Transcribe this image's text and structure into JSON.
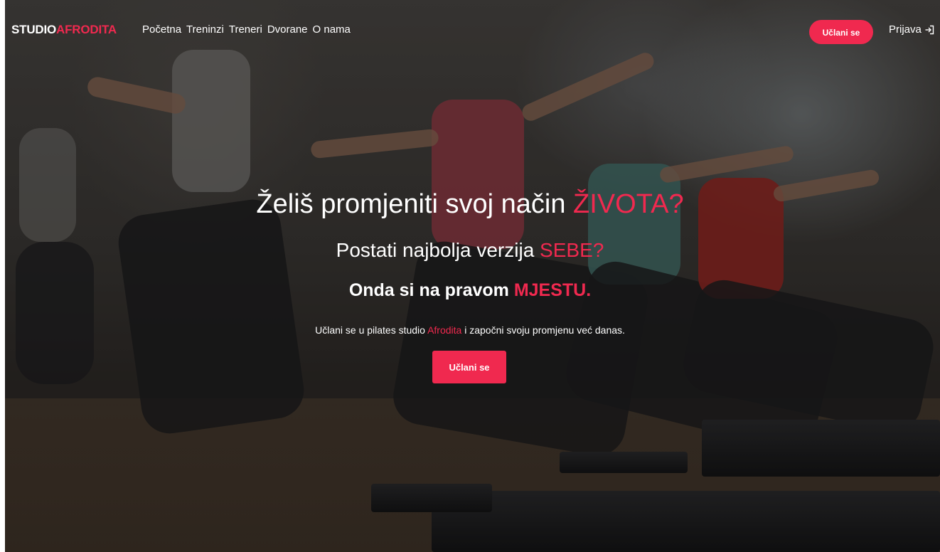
{
  "navbar": {
    "brand_part1": "STUDIO",
    "brand_part2": "AFRODITA",
    "links": [
      "Početna",
      "Treninzi",
      "Treneri",
      "Dvorane",
      "O nama"
    ],
    "join_button": "Učlani se",
    "login_label": "Prijava",
    "login_icon": "sign-in-icon"
  },
  "hero": {
    "line1_text": "Želiš promjeniti svoj način ",
    "line1_accent": "ŽIVOTA?",
    "line2_text": "Postati najbolja verzija ",
    "line2_accent": "SEBE?",
    "line3_text": "Onda si na pravom ",
    "line3_accent": "MJESTU.",
    "subtitle_before": "Učlani se u pilates studio ",
    "subtitle_accent": "Afrodita",
    "subtitle_after": " i započni svoju promjenu već danas.",
    "cta_button": "Učlani se"
  },
  "colors": {
    "accent": "#f0294f",
    "text": "#ffffff"
  }
}
